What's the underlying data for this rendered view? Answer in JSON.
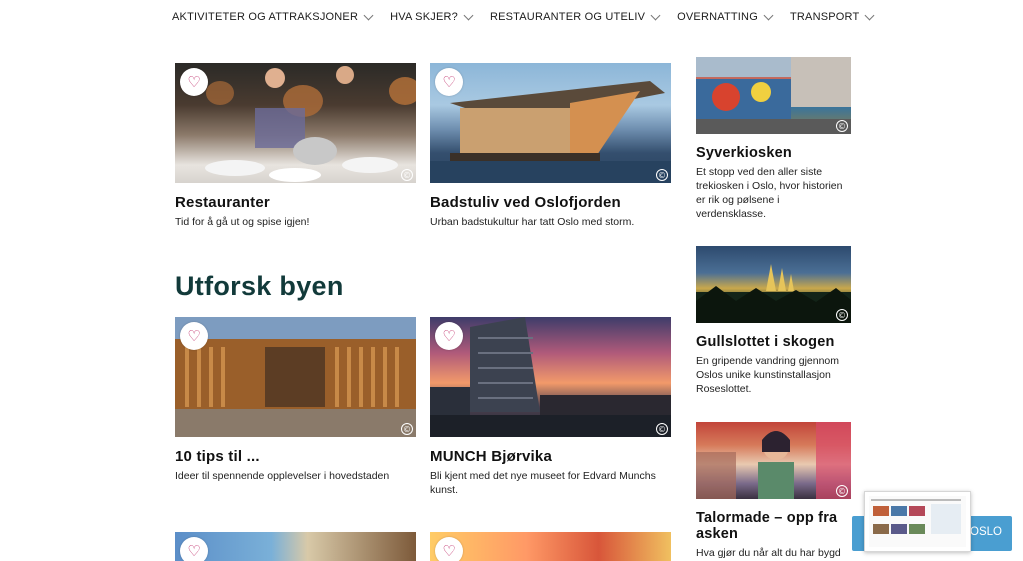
{
  "nav": {
    "items": [
      {
        "label": "AKTIVITETER OG ATTRAKSJONER"
      },
      {
        "label": "HVA SKJER?"
      },
      {
        "label": "RESTAURANTER OG UTELIV"
      },
      {
        "label": "OVERNATTING"
      },
      {
        "label": "TRANSPORT"
      }
    ]
  },
  "cards_top": [
    {
      "title": "Restauranter",
      "desc": "Tid for å gå ut og spise igjen!"
    },
    {
      "title": "Badstuliv ved Oslofjorden",
      "desc": "Urban badstukultur har tatt Oslo med storm."
    }
  ],
  "section": {
    "heading": "Utforsk byen"
  },
  "cards_explore": [
    {
      "title": "10 tips til ...",
      "desc": "Ideer til spennende opplevelser i hovedstaden"
    },
    {
      "title": "MUNCH Bjørvika",
      "desc": "Bli kjent med det nye museet for Edvard Munchs kunst."
    }
  ],
  "sidebar": [
    {
      "title": "Syverkiosken",
      "desc": "Et stopp ved den aller siste trekiosken i Oslo, hvor historien er rik og pølsene i verdensklasse."
    },
    {
      "title": "Gullslottet i skogen",
      "desc": "En gripende vandring gjennom Oslos unike kunstinstallasjon Roseslottet."
    },
    {
      "title": "Talormade – opp fra asken",
      "desc": "Hva gjør du når alt du har bygd"
    }
  ],
  "icons": {
    "heart": "heart-icon",
    "copyright": "copyright-icon",
    "chevron": "chevron-down-icon"
  },
  "widget": {
    "label": "OSLO"
  },
  "symbols": {
    "heart": "♡",
    "copyright": "©"
  },
  "colors": {
    "heading": "#123a3a",
    "heart": "#c0306b",
    "widget": "#4a9ed1"
  }
}
